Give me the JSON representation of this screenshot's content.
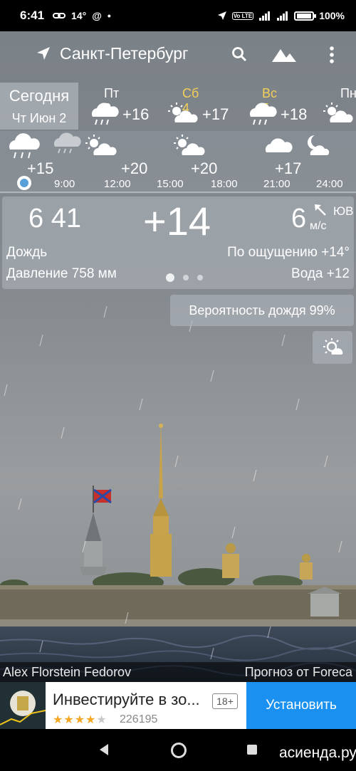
{
  "status_bar": {
    "time": "6:41",
    "temp_small": "14°",
    "battery": "100%",
    "network": "4G",
    "volte": "Vo LTE"
  },
  "app_bar": {
    "city": "Санкт-Петербург",
    "icons": [
      "location-arrow-icon",
      "search-icon",
      "landscape-icon",
      "more-vert-icon"
    ]
  },
  "daily": {
    "today_label": "Сегодня",
    "today_date": "Чт Июн 2",
    "days": [
      {
        "name": "Пт 3",
        "temp": "+16",
        "icon": "cloud-rain-icon",
        "highlight": false
      },
      {
        "name": "Сб 4",
        "temp": "+17",
        "icon": "sun-cloud-icon",
        "highlight": true
      },
      {
        "name": "Вс 5",
        "temp": "+18",
        "icon": "cloud-rain-icon",
        "highlight": true
      },
      {
        "name": "Пн",
        "temp": "",
        "icon": "sun-cloud-icon",
        "highlight": false
      }
    ]
  },
  "hourly": {
    "items": [
      {
        "time": "",
        "temp": "+15",
        "icon": "cloud-rain-icon"
      },
      {
        "time": "9:00",
        "temp": "",
        "icon": "cloud-rain-icon"
      },
      {
        "time": "12:00",
        "temp": "+20",
        "icon": "sun-cloud-icon"
      },
      {
        "time": "15:00",
        "temp": "+20",
        "icon": "sun-cloud-icon"
      },
      {
        "time": "18:00",
        "temp": "",
        "icon": "none"
      },
      {
        "time": "21:00",
        "temp": "+17",
        "icon": "cloud-icon"
      },
      {
        "time": "24:00",
        "temp": "",
        "icon": "moon-cloud-icon"
      }
    ]
  },
  "current": {
    "time_h": "6",
    "time_m": "41",
    "temp": "+14",
    "wind_speed": "6",
    "wind_unit": "м/с",
    "wind_dir": "ЮВ",
    "condition": "Дождь",
    "feels_like": "По ощущению +14°",
    "pressure": "Давление 758 мм",
    "water": "Вода +12",
    "page_count": 3,
    "active_page": 1
  },
  "rain_probability": "Вероятность дождя  99%",
  "credits": {
    "author": "Alex Florstein Fedorov",
    "provider": "Прогноз от Foreca"
  },
  "ad": {
    "title": "Инвестируйте в зо...",
    "age": "18+",
    "rating": 4,
    "reviews": "226195",
    "button": "Установить"
  },
  "nav": {
    "watermark": "асиенда.ру"
  },
  "colors": {
    "highlight_day": "#f3cf57",
    "install_button": "#1a90f0",
    "current_hour_dot": "#5aa0d8"
  }
}
